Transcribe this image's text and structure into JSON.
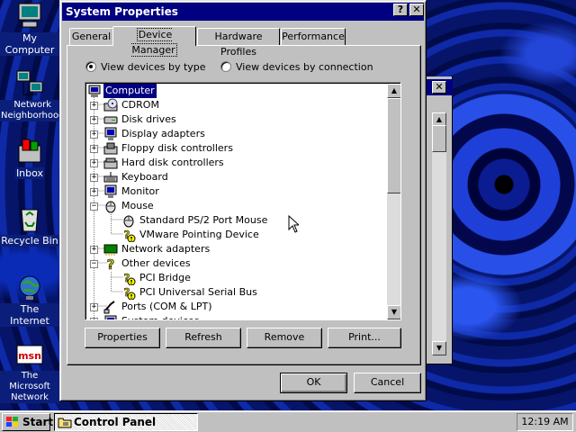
{
  "desktop": {
    "icons": [
      {
        "label": "My Computer",
        "icon": "computer-icon"
      },
      {
        "label": "Network Neighborhood",
        "icon": "network-icon"
      },
      {
        "label": "Inbox",
        "icon": "inbox-icon"
      },
      {
        "label": "Recycle Bin",
        "icon": "recycle-bin-icon"
      },
      {
        "label": "The Internet",
        "icon": "internet-icon"
      },
      {
        "label": "The Microsoft Network",
        "icon": "msn-icon"
      }
    ]
  },
  "dialog": {
    "title": "System Properties",
    "help_button": "?",
    "close_button": "✕",
    "tabs": [
      {
        "label": "General",
        "active": false
      },
      {
        "label": "Device Manager",
        "active": true
      },
      {
        "label": "Hardware Profiles",
        "active": false
      },
      {
        "label": "Performance",
        "active": false
      }
    ],
    "view_options": {
      "by_type": {
        "label": "View devices by type",
        "selected": true
      },
      "by_connection": {
        "label": "View devices by connection",
        "selected": false
      }
    },
    "tree": [
      {
        "label": "Computer",
        "level": 0,
        "expander": "",
        "icon": "computer-icon",
        "selected": true
      },
      {
        "label": "CDROM",
        "level": 1,
        "expander": "+",
        "icon": "cdrom-icon"
      },
      {
        "label": "Disk drives",
        "level": 1,
        "expander": "+",
        "icon": "disk-drive-icon"
      },
      {
        "label": "Display adapters",
        "level": 1,
        "expander": "+",
        "icon": "display-adapter-icon"
      },
      {
        "label": "Floppy disk controllers",
        "level": 1,
        "expander": "+",
        "icon": "floppy-controller-icon"
      },
      {
        "label": "Hard disk controllers",
        "level": 1,
        "expander": "+",
        "icon": "hard-disk-controller-icon"
      },
      {
        "label": "Keyboard",
        "level": 1,
        "expander": "+",
        "icon": "keyboard-icon"
      },
      {
        "label": "Monitor",
        "level": 1,
        "expander": "+",
        "icon": "monitor-icon"
      },
      {
        "label": "Mouse",
        "level": 1,
        "expander": "−",
        "icon": "mouse-icon"
      },
      {
        "label": "Standard PS/2 Port Mouse",
        "level": 2,
        "expander": "",
        "icon": "mouse-icon"
      },
      {
        "label": "VMware Pointing Device",
        "level": 2,
        "expander": "",
        "icon": "warning-device-icon"
      },
      {
        "label": "Network adapters",
        "level": 1,
        "expander": "+",
        "icon": "network-adapter-icon"
      },
      {
        "label": "Other devices",
        "level": 1,
        "expander": "−",
        "icon": "unknown-device-icon"
      },
      {
        "label": "PCI Bridge",
        "level": 2,
        "expander": "",
        "icon": "warning-device-icon"
      },
      {
        "label": "PCI Universal Serial Bus",
        "level": 2,
        "expander": "",
        "icon": "warning-device-icon"
      },
      {
        "label": "Ports (COM & LPT)",
        "level": 1,
        "expander": "+",
        "icon": "port-icon"
      },
      {
        "label": "System devices",
        "level": 1,
        "expander": "+",
        "icon": "system-device-icon"
      }
    ],
    "buttons": {
      "properties": "Properties",
      "refresh": "Refresh",
      "remove": "Remove",
      "print": "Print...",
      "ok": "OK",
      "cancel": "Cancel"
    }
  },
  "taskbar": {
    "start_label": "Start",
    "task_label": "Control Panel",
    "clock": "12:19 AM"
  },
  "colors": {
    "titlebar": "#000080",
    "face": "#c0c0c0",
    "desktop": "#0b1f7a",
    "selection": "#000080"
  }
}
